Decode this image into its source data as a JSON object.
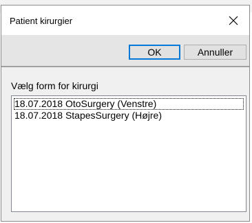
{
  "dialog": {
    "title": "Patient kirurgier",
    "close_icon": "close-icon"
  },
  "toolbar": {
    "ok_label": "OK",
    "cancel_label": "Annuller"
  },
  "section": {
    "label": "Vælg form for kirurgi"
  },
  "surgeries": {
    "items": [
      {
        "label": "18.07.2018 OtoSurgery (Venstre)"
      },
      {
        "label": "18.07.2018 StapesSurgery (Højre)"
      }
    ],
    "focused_index": 0
  },
  "colors": {
    "dialog_bg": "#f0f0f0",
    "titlebar_bg": "#ffffff",
    "toolbar_bg": "#e5e5e5",
    "default_button_border": "#0078d7",
    "list_bg": "#ffffff"
  }
}
